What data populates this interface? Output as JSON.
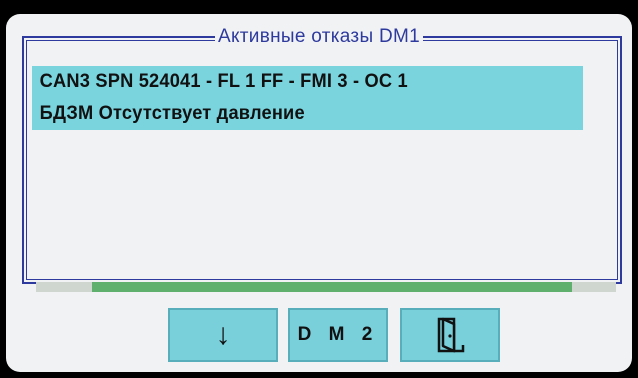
{
  "panel": {
    "title": "Активные отказы DM1"
  },
  "faults": [
    "CAN3 SPN 524041 - FL 1 FF - FMI 3 - OC 1",
    "БДЗМ Отсутствует давление"
  ],
  "buttons": {
    "down_icon": "arrow-down-icon",
    "down_glyph": "↓",
    "dm2_label": "D M 2",
    "exit_icon": "door-exit-icon"
  },
  "colors": {
    "frame": "#2e3a9e",
    "highlight": "#79d4de",
    "button": "#79d0db",
    "status": "#5fb06d"
  }
}
